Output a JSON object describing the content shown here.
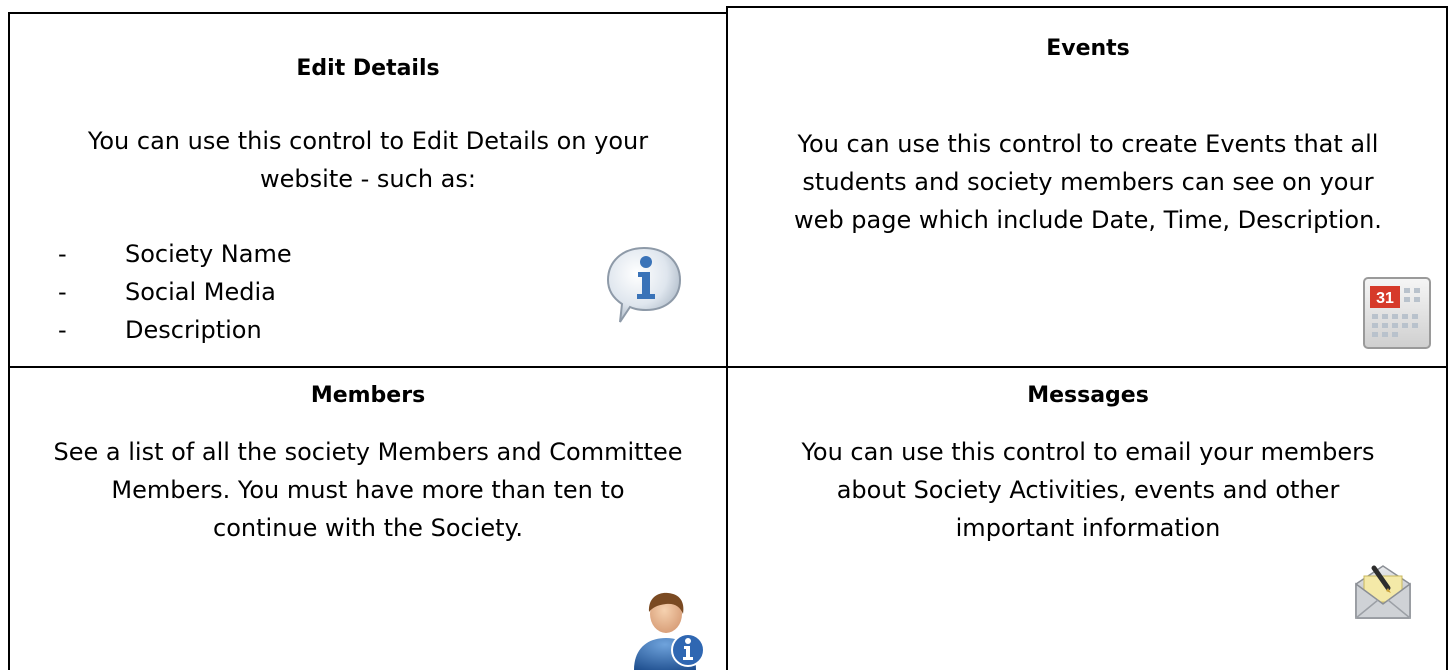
{
  "cells": {
    "edit_details": {
      "title": "Edit Details",
      "lines": [
        "You can use this control to Edit Details on your",
        "website - such as:"
      ],
      "bullets": [
        "Society Name",
        "Social Media",
        "Description"
      ],
      "bullet_marker": "-",
      "icon": "info-speech-bubble-icon"
    },
    "events": {
      "title": "Events",
      "lines": [
        "You can use this control to create Events that all",
        "students and society members can see on your",
        "web page which include Date, Time, Description."
      ],
      "icon": "calendar-icon",
      "icon_text": "31"
    },
    "members": {
      "title": "Members",
      "lines": [
        "See a list of all the society Members and Committee",
        "Members. You must have more than ten to",
        "continue with the Society."
      ],
      "icon": "user-info-icon"
    },
    "messages": {
      "title": "Messages",
      "lines": [
        "You can use this control to email your members",
        "about Society Activities, events and other",
        "important information"
      ],
      "icon": "envelope-pen-icon"
    }
  },
  "colors": {
    "border": "#000000",
    "calendar_red": "#d63a2a",
    "info_blue": "#3a73b8"
  }
}
